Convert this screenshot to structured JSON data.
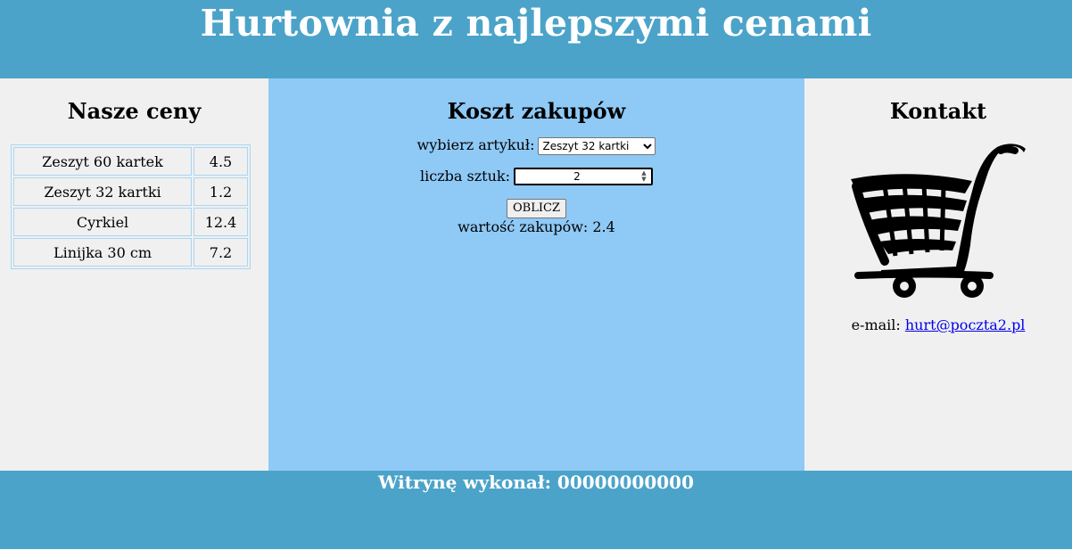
{
  "header": {
    "title": "Hurtownia z najlepszymi cenami"
  },
  "left": {
    "heading": "Nasze ceny",
    "prices": [
      {
        "name": "Zeszyt 60 kartek",
        "price": "4.5"
      },
      {
        "name": "Zeszyt 32 kartki",
        "price": "1.2"
      },
      {
        "name": "Cyrkiel",
        "price": "12.4"
      },
      {
        "name": "Linijka 30 cm",
        "price": "7.2"
      }
    ]
  },
  "middle": {
    "heading": "Koszt zakupów",
    "select_label": "wybierz artykuł:",
    "select_value": "Zeszyt 32 kartki",
    "qty_label": "liczba sztuk:",
    "qty_value": "2",
    "button_label": "OBLICZ",
    "result_text": "wartość zakupów: 2.4"
  },
  "right": {
    "heading": "Kontakt",
    "email_label": "e-mail:",
    "email_link": "hurt@poczta2.pl",
    "cart_icon": "shopping-cart-icon"
  },
  "footer": {
    "text": "Witrynę wykonał: 00000000000"
  },
  "colors": {
    "banner": "#4ca3c9",
    "side_panel": "#f0f0f0",
    "middle_panel": "#8fc9f6",
    "table_border": "#a8d6f2",
    "link": "#0000ee"
  }
}
